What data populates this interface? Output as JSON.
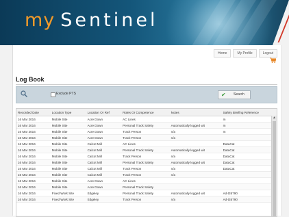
{
  "header": {
    "logo_prefix": "my",
    "logo_main": "Sentinel"
  },
  "nav": {
    "home": "Home",
    "profile": "My Profile",
    "logout": "Logout"
  },
  "page": {
    "title": "Log Book"
  },
  "filter": {
    "checkbox_label": "Exclude PTS",
    "search_label": "Search",
    "checked": false
  },
  "table": {
    "columns": [
      "Recorded Date",
      "Location Type",
      "Location Or Ref",
      "Roles Or Competence",
      "Notes",
      "Safety Briefing Reference"
    ],
    "rows": [
      [
        "16 Mar 2016",
        "Mobile Site",
        "Acre Down",
        "AC Lines",
        "",
        "m"
      ],
      [
        "16 Mar 2016",
        "Mobile Site",
        "Acre Down",
        "Personal Track Safety",
        "Automatically logged wit",
        "m"
      ],
      [
        "16 Mar 2016",
        "Mobile Site",
        "Acre Down",
        "Track Person",
        "n/a",
        "m"
      ],
      [
        "16 Mar 2016",
        "Mobile Site",
        "Acre Down",
        "Track Person",
        "n/a",
        ""
      ],
      [
        "16 Mar 2016",
        "Mobile Site",
        "Calcot Mill",
        "AC Lines",
        "",
        "DataCat"
      ],
      [
        "16 Mar 2016",
        "Mobile Site",
        "Calcot Mill",
        "Personal Track Safety",
        "Automatically logged wit",
        "DataCat"
      ],
      [
        "16 Mar 2016",
        "Mobile Site",
        "Calcot Mill",
        "Track Person",
        "n/a",
        "DataCat"
      ],
      [
        "16 Mar 2016",
        "Mobile Site",
        "Calcot Mill",
        "Personal Track Safety",
        "Automatically logged wit",
        "DataCat"
      ],
      [
        "16 Mar 2016",
        "Mobile Site",
        "Calcot Mill",
        "Track Person",
        "n/a",
        "DataCat"
      ],
      [
        "16 Mar 2016",
        "Mobile Site",
        "Calcot Mill",
        "Track Person",
        "n/a",
        ""
      ],
      [
        "16 Mar 2016",
        "Mobile Site",
        "Acre Down",
        "AC Lines",
        "",
        ""
      ],
      [
        "16 Mar 2016",
        "Mobile Site",
        "Acre Down",
        "Personal Track Safety",
        "",
        ""
      ],
      [
        "16 Mar 2016",
        "Fixed Work Site",
        "Edgeley",
        "Personal Track Safety",
        "Automatically logged wit",
        "Ad-t35790"
      ],
      [
        "16 Mar 2016",
        "Fixed Work Site",
        "Edgeley",
        "Track Person",
        "n/a",
        "Ad-t35790"
      ]
    ]
  }
}
